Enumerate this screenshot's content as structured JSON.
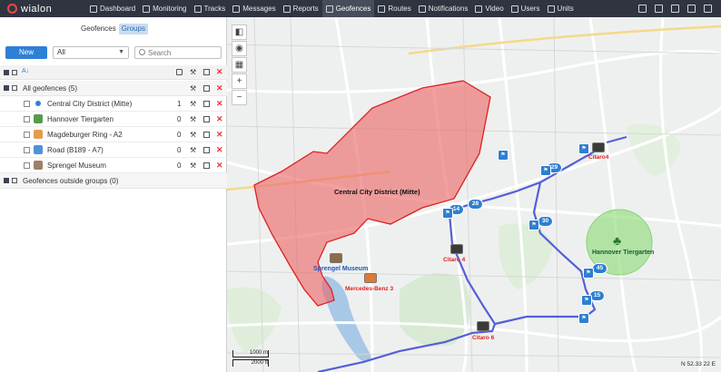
{
  "app": {
    "logo_text": "wialon"
  },
  "nav": [
    {
      "label": "Dashboard",
      "icon": "dashboard-icon"
    },
    {
      "label": "Monitoring",
      "icon": "monitoring-icon"
    },
    {
      "label": "Tracks",
      "icon": "tracks-icon"
    },
    {
      "label": "Messages",
      "icon": "messages-icon"
    },
    {
      "label": "Reports",
      "icon": "reports-icon"
    },
    {
      "label": "Geofences",
      "icon": "geofences-icon",
      "active": true
    },
    {
      "label": "Routes",
      "icon": "routes-icon"
    },
    {
      "label": "Notifications",
      "icon": "notifications-icon"
    },
    {
      "label": "Video",
      "icon": "video-icon"
    },
    {
      "label": "Users",
      "icon": "users-icon"
    },
    {
      "label": "Units",
      "icon": "units-icon"
    }
  ],
  "panel": {
    "tabs": [
      {
        "label": "Geofences"
      },
      {
        "label": "Groups",
        "active": true
      }
    ],
    "new_label": "New",
    "filter_value": "All",
    "search_placeholder": "Search",
    "groups": [
      {
        "label": "All geofences (5)"
      },
      {
        "label": "Geofences outside groups (0)"
      }
    ],
    "items": [
      {
        "label": "Central City District (Mitte)",
        "count": "1",
        "icon": "dot-icon"
      },
      {
        "label": "Hannover Tiergarten",
        "count": "0",
        "icon": "tree-icon"
      },
      {
        "label": "Magdeburger Ring - A2",
        "count": "0",
        "icon": "pin-icon"
      },
      {
        "label": "Road (B189 - A7)",
        "count": "0",
        "icon": "road-icon"
      },
      {
        "label": "Sprengel Museum",
        "count": "0",
        "icon": "photo-icon"
      }
    ]
  },
  "map": {
    "geofence_labels": {
      "central": "Central City District (Mitte)",
      "tiergarten": "Hannover Tiergarten",
      "museum": "Sprengel Museum"
    },
    "units": [
      "Citaro4",
      "Citaro 4",
      "Mercedes-Benz 3",
      "Citaro 6"
    ],
    "badges": [
      "14",
      "28",
      "29",
      "30",
      "45",
      "15"
    ],
    "scale": {
      "top": "1000 m",
      "bottom": "2000 ft"
    },
    "coords": "N 52.33 22 E"
  }
}
